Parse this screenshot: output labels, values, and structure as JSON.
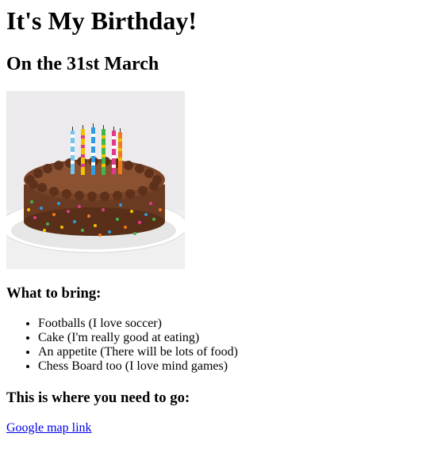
{
  "page": {
    "title": "It's My Birthday!",
    "date_heading": "On the 31st March",
    "image": {
      "icon": "birthday-cake-image"
    },
    "bring": {
      "heading": "What to bring:",
      "items": [
        "Footballs (I love soccer)",
        "Cake (I'm really good at eating)",
        "An appetite (There will be lots of food)",
        "Chess Board too (I love mind games)"
      ]
    },
    "directions": {
      "heading": "This is where you need to go:",
      "link_label": "Google map link"
    },
    "colors": {
      "link": "#0000ee",
      "text": "#000000",
      "background": "#ffffff"
    }
  }
}
